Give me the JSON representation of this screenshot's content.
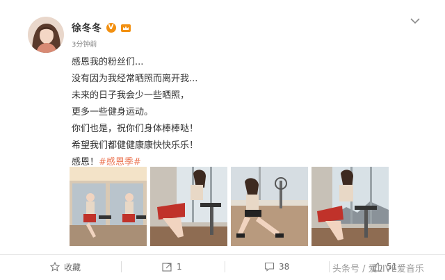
{
  "post": {
    "username": "徐冬冬",
    "verified_badge": "V",
    "timestamp": "3分钟前",
    "text_lines": [
      "感恩我的粉丝们...",
      "没有因为我经常晒照而离开我...",
      "未来的日子我会少一些晒照，",
      "更多一些健身运动。",
      "你们也是，祝你们身体棒棒哒！",
      "希望我们都健健康康快快乐乐！"
    ],
    "last_line_prefix": "感恩！",
    "hashtag": "#感恩季#",
    "photos": [
      {
        "description_icon": "photo-spin-bike-twin"
      },
      {
        "description_icon": "photo-spin-bike-window"
      },
      {
        "description_icon": "photo-floor-pose"
      },
      {
        "description_icon": "photo-spin-bike-city"
      }
    ]
  },
  "actions": {
    "favorite_label": "收藏",
    "repost_count": "1",
    "comment_count": "38",
    "like_count": "51"
  },
  "watermark": "头条号 / 爱LIVE爱音乐",
  "colors": {
    "hashtag": "#eb7350",
    "badge": "#f29011",
    "background": "#ffffff"
  },
  "icons": {
    "more": "chevron-down-icon",
    "favorite": "star-icon",
    "repost": "share-icon",
    "comment": "comment-icon",
    "like": "thumbs-up-icon"
  }
}
